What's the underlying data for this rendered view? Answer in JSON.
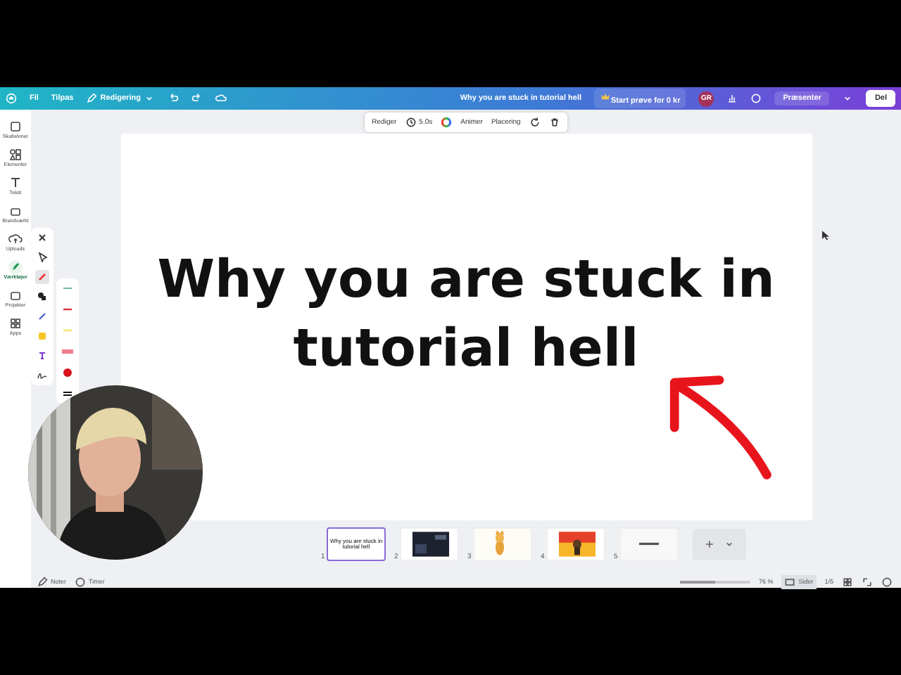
{
  "topbar": {
    "menu": [
      "Fil",
      "Tilpas"
    ],
    "mode": "Redigering",
    "title": "Why you are stuck in tutorial hell",
    "trial": "Start prøve for 0 kr",
    "avatar": "GR",
    "present": "Præsenter",
    "share": "Del"
  },
  "element_toolbar": {
    "edit": "Rediger",
    "duration": "5.0s",
    "animate": "Animer",
    "position": "Placering"
  },
  "sidebar": {
    "items": [
      {
        "label": "Skabeloner",
        "selected": false
      },
      {
        "label": "Elementer",
        "selected": false
      },
      {
        "label": "Tekst",
        "selected": false
      },
      {
        "label": "Brandværkt",
        "selected": false
      },
      {
        "label": "Uploads",
        "selected": false
      },
      {
        "label": "Værktøjer",
        "selected": true
      },
      {
        "label": "Projekter",
        "selected": false
      },
      {
        "label": "Apps",
        "selected": false
      }
    ]
  },
  "slide": {
    "heading": "Why you are stuck in tutorial hell"
  },
  "pages": [
    {
      "number": "1",
      "kind": "text",
      "text": "Why you are stuck in tutorial hell",
      "selected": true
    },
    {
      "number": "2",
      "kind": "dark",
      "selected": false
    },
    {
      "number": "3",
      "kind": "cat",
      "selected": false
    },
    {
      "number": "4",
      "kind": "fire",
      "selected": false
    },
    {
      "number": "5",
      "kind": "line",
      "selected": false
    }
  ],
  "status_bar": {
    "notes": "Noter",
    "timer": "Timer",
    "zoom": {
      "level": 0.5
    },
    "zoom_text": "76 %",
    "pages_view": "Sider",
    "page_count": "1/5"
  }
}
